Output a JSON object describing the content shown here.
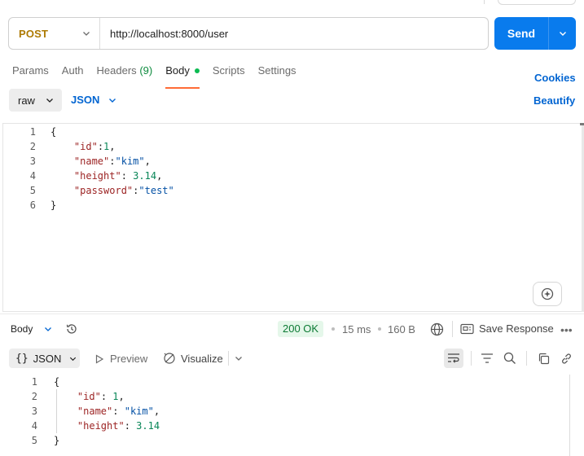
{
  "request": {
    "method": "POST",
    "url": "http://localhost:8000/user",
    "send_label": "Send"
  },
  "tabs": [
    {
      "label": "Params"
    },
    {
      "label": "Auth"
    },
    {
      "label": "Headers",
      "count": "(9)"
    },
    {
      "label": "Body",
      "active": true
    },
    {
      "label": "Scripts"
    },
    {
      "label": "Settings"
    }
  ],
  "links": {
    "cookies": "Cookies",
    "beautify": "Beautify"
  },
  "body_mode": {
    "type": "raw",
    "language": "JSON"
  },
  "request_body": [
    {
      "ln": "1",
      "text": "{"
    },
    {
      "ln": "2",
      "key": "\"id\"",
      "sep": ":",
      "val": "1",
      "vtype": "n",
      "tail": ","
    },
    {
      "ln": "3",
      "key": "\"name\"",
      "sep": ":",
      "val": "\"kim\"",
      "vtype": "s",
      "tail": ","
    },
    {
      "ln": "4",
      "key": "\"height\"",
      "sep": ": ",
      "val": "3.14",
      "vtype": "n",
      "tail": ","
    },
    {
      "ln": "5",
      "key": "\"password\"",
      "sep": ":",
      "val": "\"test\"",
      "vtype": "s",
      "tail": ""
    },
    {
      "ln": "6",
      "text": "}"
    }
  ],
  "response": {
    "section_label": "Body",
    "status": "200 OK",
    "time": "15 ms",
    "size": "160 B",
    "save_label": "Save Response",
    "format": "JSON",
    "preview_label": "Preview",
    "visualize_label": "Visualize",
    "body": [
      {
        "ln": "1",
        "text": "{"
      },
      {
        "ln": "2",
        "key": "\"id\"",
        "sep": ": ",
        "val": "1",
        "vtype": "n",
        "tail": ","
      },
      {
        "ln": "3",
        "key": "\"name\"",
        "sep": ": ",
        "val": "\"kim\"",
        "vtype": "s",
        "tail": ","
      },
      {
        "ln": "4",
        "key": "\"height\"",
        "sep": ": ",
        "val": "3.14",
        "vtype": "n",
        "tail": ""
      },
      {
        "ln": "5",
        "text": "}"
      }
    ]
  },
  "colors": {
    "accent_blue": "#097bed",
    "method_post": "#ad7a03",
    "tab_indicator": "#ff6c37",
    "status_ok": "#0c7a34"
  }
}
